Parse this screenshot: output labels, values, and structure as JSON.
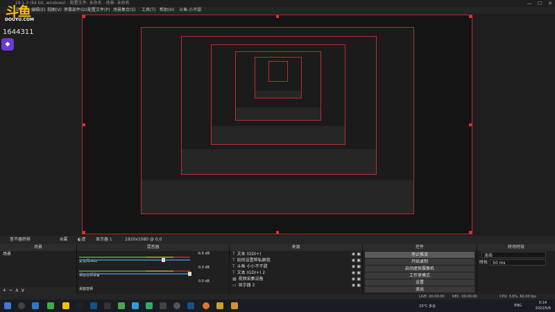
{
  "window": {
    "title": "28.1.3 (64 bit, windows) - 配置文件: 未命名 - 场景: 未命名"
  },
  "menu": [
    "文件(F)",
    "编辑(E)",
    "视图(V)",
    "停靠部件(D)",
    "配置文件(P)",
    "场景集合(S)",
    "工具(T)",
    "帮助(H)",
    "斗鱼-小不甜"
  ],
  "brand": {
    "logo_text": "斗鱼",
    "logo_sub": "DOUYU.COM",
    "room_id": "1644311"
  },
  "scenebar": {
    "label": "昔不器转移",
    "props": "属性",
    "filters": "滤镜",
    "display_capture": "显示器 1",
    "res": "1920x1080 @ 0,0"
  },
  "panels": {
    "scenes": {
      "title": "场景",
      "items": [
        "场景"
      ]
    },
    "mixer": {
      "title": "混音器",
      "channels": [
        {
          "name": "麦克风/Aux",
          "db": "-6.6 dB"
        },
        {
          "name": "桌面音频设备",
          "db": "0.0 dB"
        },
        {
          "name": "桌面音频",
          "db": "0.0 dB"
        }
      ]
    },
    "sources": {
      "title": "来源",
      "items": [
        "文本 (GDI+)",
        "如何设置帮私聊我",
        "斗鱼 小小不不甜",
        "文本 (GDI+) 2",
        "视频采集设备",
        "显示器 2"
      ]
    },
    "controls": {
      "title": "控件",
      "buttons": [
        "停止推流",
        "开始录制",
        "启动虚拟摄像机",
        "工作室模式",
        "设置",
        "退出"
      ]
    },
    "transitions": {
      "title": "转场特效",
      "type": "淡出",
      "duration_label": "时长",
      "duration": "50 ms"
    }
  },
  "statusbar": {
    "live": "LIVE: 00:00:00",
    "rec": "REC: 00:00:00",
    "cpu": "CPU: 3.6%, 60.00 fps"
  },
  "taskbar": {
    "weather": "23°C 多云",
    "lang": "ENG",
    "time": "0:14",
    "date": "2022/5/6"
  },
  "colors": {
    "accent_red": "#c02a2a",
    "logo_yellow": "#f6c000",
    "badge_purple": "#6a3bd1"
  }
}
